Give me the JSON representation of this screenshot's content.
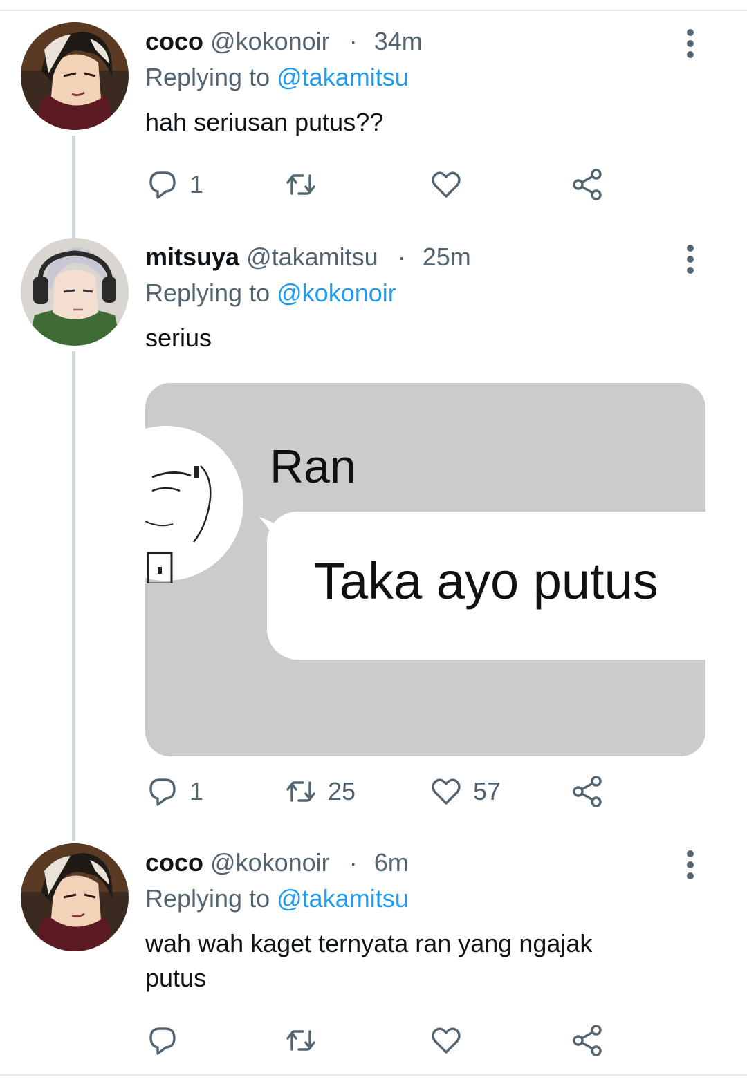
{
  "tweets": [
    {
      "display_name": "coco",
      "handle": "@kokonoir",
      "dot": "·",
      "time": "34m",
      "replying_prefix": "Replying to",
      "replying_to": "@takamitsu",
      "text": "hah seriusan putus??",
      "reply_count": "1",
      "retweet_count": "",
      "like_count": ""
    },
    {
      "display_name": "mitsuya",
      "handle": "@takamitsu",
      "dot": "·",
      "time": "25m",
      "replying_prefix": "Replying to",
      "replying_to": "@kokonoir",
      "text": "serius",
      "media": {
        "sender_name": "Ran",
        "message": "Taka ayo putus"
      },
      "reply_count": "1",
      "retweet_count": "25",
      "like_count": "57"
    },
    {
      "display_name": "coco",
      "handle": "@kokonoir",
      "dot": "·",
      "time": "6m",
      "replying_prefix": "Replying to",
      "replying_to": "@takamitsu",
      "text": "wah wah kaget ternyata ran yang ngajak putus",
      "reply_count": "",
      "retweet_count": "",
      "like_count": ""
    }
  ],
  "icons": {
    "reply": "reply-icon",
    "retweet": "retweet-icon",
    "like": "heart-icon",
    "share": "share-icon",
    "more": "more-vertical-icon"
  },
  "colors": {
    "mention": "#1d9bf0",
    "secondary_text": "#536471",
    "primary_text": "#0f1419",
    "thread_line": "#cfd9de",
    "media_background": "#cbcbcb"
  }
}
